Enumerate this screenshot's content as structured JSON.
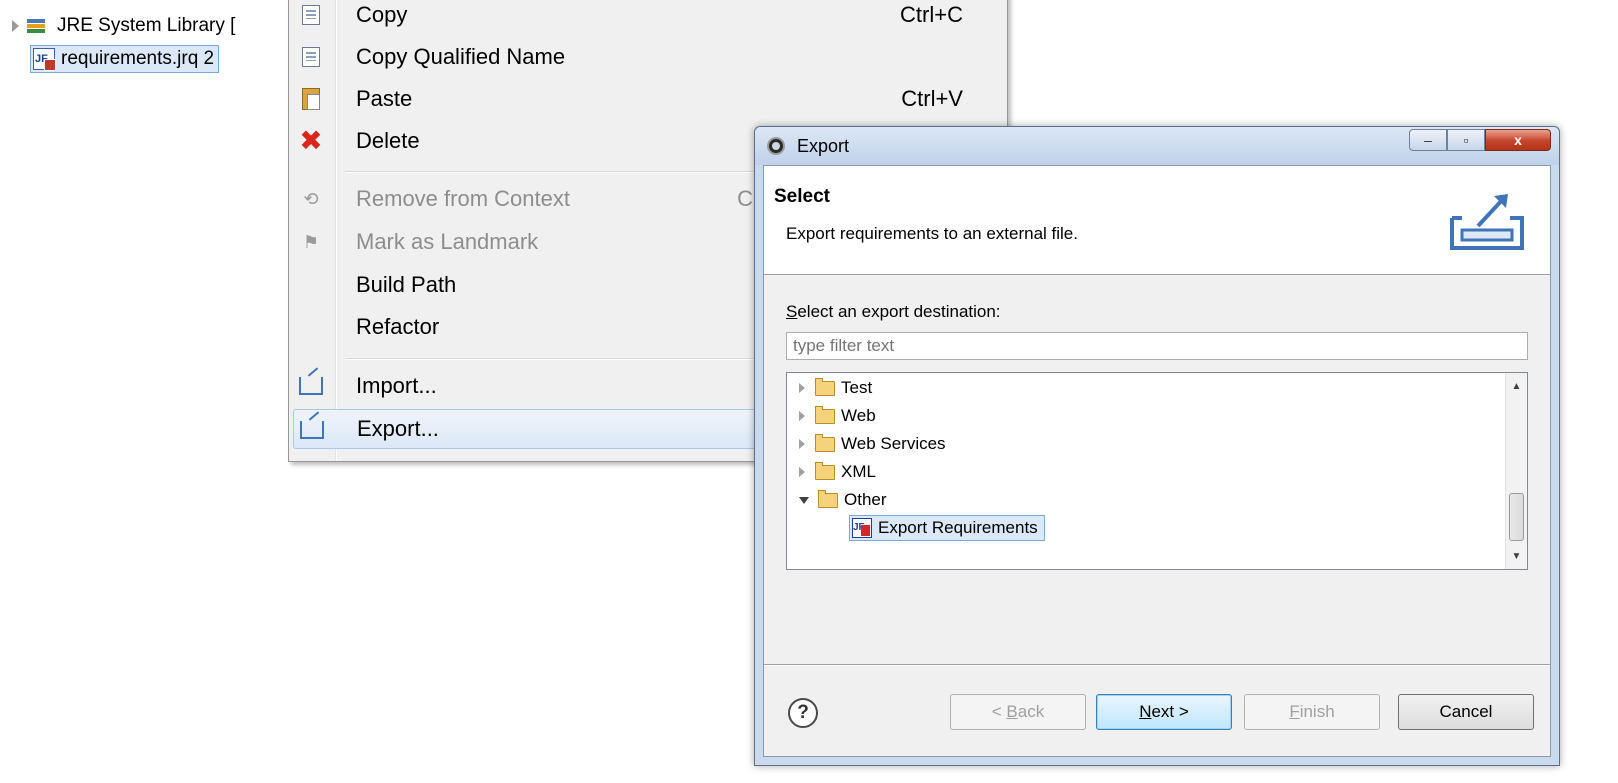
{
  "explorer": {
    "items": [
      {
        "label": "JRE System Library [",
        "icon": "library-icon"
      },
      {
        "label": "requirements.jrq 2",
        "icon": "jrq-file-icon"
      }
    ]
  },
  "context_menu": {
    "items": [
      {
        "label": "Copy",
        "accelerator": "Ctrl+C",
        "icon": "copy-icon",
        "enabled": true
      },
      {
        "label": "Copy Qualified Name",
        "accelerator": "",
        "icon": "copy-qualified-icon",
        "enabled": true
      },
      {
        "label": "Paste",
        "accelerator": "Ctrl+V",
        "icon": "paste-icon",
        "enabled": true
      },
      {
        "label": "Delete",
        "accelerator": "",
        "icon": "delete-icon",
        "enabled": true
      },
      {
        "label": "Remove from Context",
        "accelerator": "C",
        "icon": "remove-context-icon",
        "enabled": false
      },
      {
        "label": "Mark as Landmark",
        "accelerator": "",
        "icon": "landmark-icon",
        "enabled": false
      },
      {
        "label": "Build Path",
        "accelerator": "",
        "icon": "",
        "enabled": true
      },
      {
        "label": "Refactor",
        "accelerator": "",
        "icon": "",
        "enabled": true
      },
      {
        "label": "Import...",
        "accelerator": "",
        "icon": "import-icon",
        "enabled": true
      },
      {
        "label": "Export...",
        "accelerator": "",
        "icon": "export-icon",
        "enabled": true,
        "highlighted": true
      }
    ]
  },
  "dialog": {
    "title": "Export",
    "window_buttons": {
      "minimize": "–",
      "maximize": "▫",
      "close": "x"
    },
    "banner": {
      "title": "Select",
      "description": "Export requirements to an external file."
    },
    "destination_label_first": "S",
    "destination_label_rest": "elect an export destination:",
    "filter_placeholder": "type filter text",
    "tree": [
      {
        "label": "Test",
        "expanded": false
      },
      {
        "label": "Web",
        "expanded": false
      },
      {
        "label": "Web Services",
        "expanded": false
      },
      {
        "label": "XML",
        "expanded": false
      },
      {
        "label": "Other",
        "expanded": true
      },
      {
        "label": "Export Requirements",
        "selected": true
      }
    ],
    "help_glyph": "?",
    "buttons": {
      "back": {
        "prefix": "< ",
        "mnemonic": "B",
        "rest": "ack",
        "enabled": false
      },
      "next": {
        "prefix": "",
        "mnemonic": "N",
        "rest": "ext >",
        "enabled": true
      },
      "finish": {
        "prefix": "",
        "mnemonic": "F",
        "rest": "inish",
        "enabled": false
      },
      "cancel": {
        "label": "Cancel",
        "enabled": true
      }
    }
  },
  "colors": {
    "selection": "#dbe8f7",
    "selection_border": "#7aa7d8",
    "dialog_frame": "#c9daee",
    "close_button": "#c5442a"
  }
}
